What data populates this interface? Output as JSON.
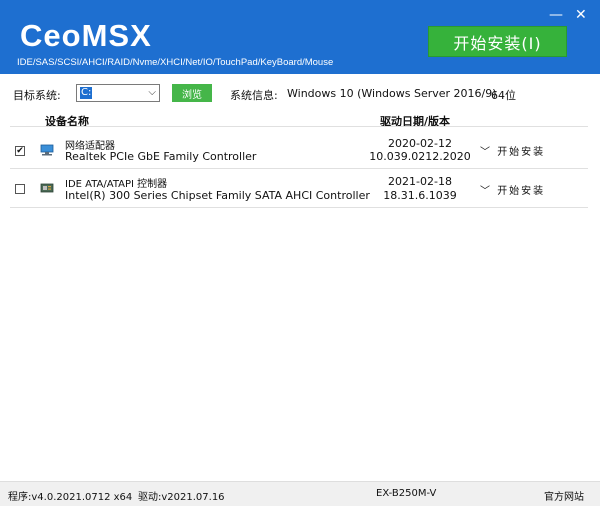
{
  "header": {
    "logo": "CeoMSX",
    "subtitle": "IDE/SAS/SCSI/AHCI/RAID/Nvme/XHCI/Net/IO/TouchPad/KeyBoard/Mouse",
    "install_all_label": "开始安装(I)",
    "minimize_symbol": "—",
    "close_symbol": "✕"
  },
  "toolbar": {
    "target_label": "目标系统:",
    "target_value": "C:",
    "browse_label": "浏览",
    "sysinfo_label": "系统信息:",
    "sysinfo_value": "Windows 10 (Windows Server 2016/9)",
    "arch": "64位"
  },
  "table": {
    "headers": {
      "device": "设备名称",
      "driver": "驱动日期/版本"
    },
    "rows": [
      {
        "checked": true,
        "icon": "network-adapter-icon",
        "category": "网络适配器",
        "model": "Realtek PCIe GbE Family Controller",
        "date": "2020-02-12",
        "version": "10.039.0212.2020",
        "action": "开始安装",
        "chevron": "﹀"
      },
      {
        "checked": false,
        "icon": "disk-controller-icon",
        "category": "IDE ATA/ATAPI 控制器",
        "model": "Intel(R) 300 Series Chipset Family SATA AHCI Controller",
        "date": "2021-02-18",
        "version": "18.31.6.1039",
        "action": "开始安装",
        "chevron": "﹀"
      }
    ]
  },
  "footer": {
    "program_version": "程序:v4.0.2021.0712 x64",
    "driver_version": "驱动:v2021.07.16",
    "board": "EX-B250M-V",
    "website": "官方网站"
  },
  "colors": {
    "header_bg": "#1e6fd0",
    "install_green": "#36b23b"
  }
}
